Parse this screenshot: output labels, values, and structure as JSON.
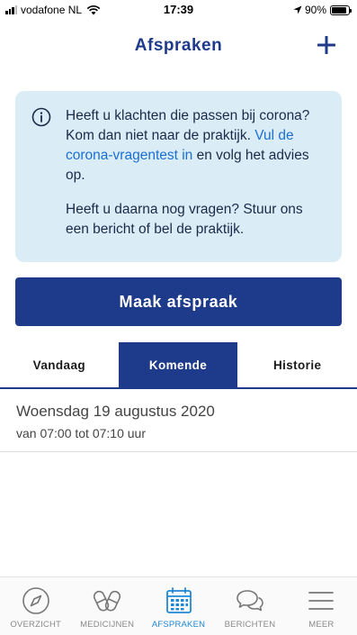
{
  "status_bar": {
    "carrier": "vodafone NL",
    "time": "17:39",
    "battery": "90%",
    "battery_level": 0.9
  },
  "header": {
    "title": "Afspraken",
    "add_icon": "plus-icon"
  },
  "info": {
    "icon": "info-circle-icon",
    "para1_text": "Heeft u klachten die passen bij corona? Kom dan niet naar de praktijk. ",
    "para1_link": "Vul de corona-vragentest in",
    "para1_after": " en volg het advies op.",
    "para2": "Heeft u daarna nog vragen? Stuur ons een bericht of bel de praktijk."
  },
  "cta": {
    "label": "Maak afspraak"
  },
  "tabs": [
    {
      "label": "Vandaag",
      "active": false
    },
    {
      "label": "Komende",
      "active": true
    },
    {
      "label": "Historie",
      "active": false
    }
  ],
  "appointments": [
    {
      "date": "Woensdag 19 augustus 2020",
      "time": "van 07:00 tot 07:10 uur"
    }
  ],
  "nav": [
    {
      "label": "OVERZICHT",
      "icon": "compass-icon",
      "active": false
    },
    {
      "label": "MEDICIJNEN",
      "icon": "pills-icon",
      "active": false
    },
    {
      "label": "AFSPRAKEN",
      "icon": "calendar-icon",
      "active": true
    },
    {
      "label": "BERICHTEN",
      "icon": "chat-bubbles-icon",
      "active": false
    },
    {
      "label": "MEER",
      "icon": "menu-icon",
      "active": false
    }
  ],
  "colors": {
    "primary": "#1e3a8a",
    "info_bg": "#daecf6",
    "link": "#1b6fd1",
    "nav_active": "#1e88d6"
  }
}
